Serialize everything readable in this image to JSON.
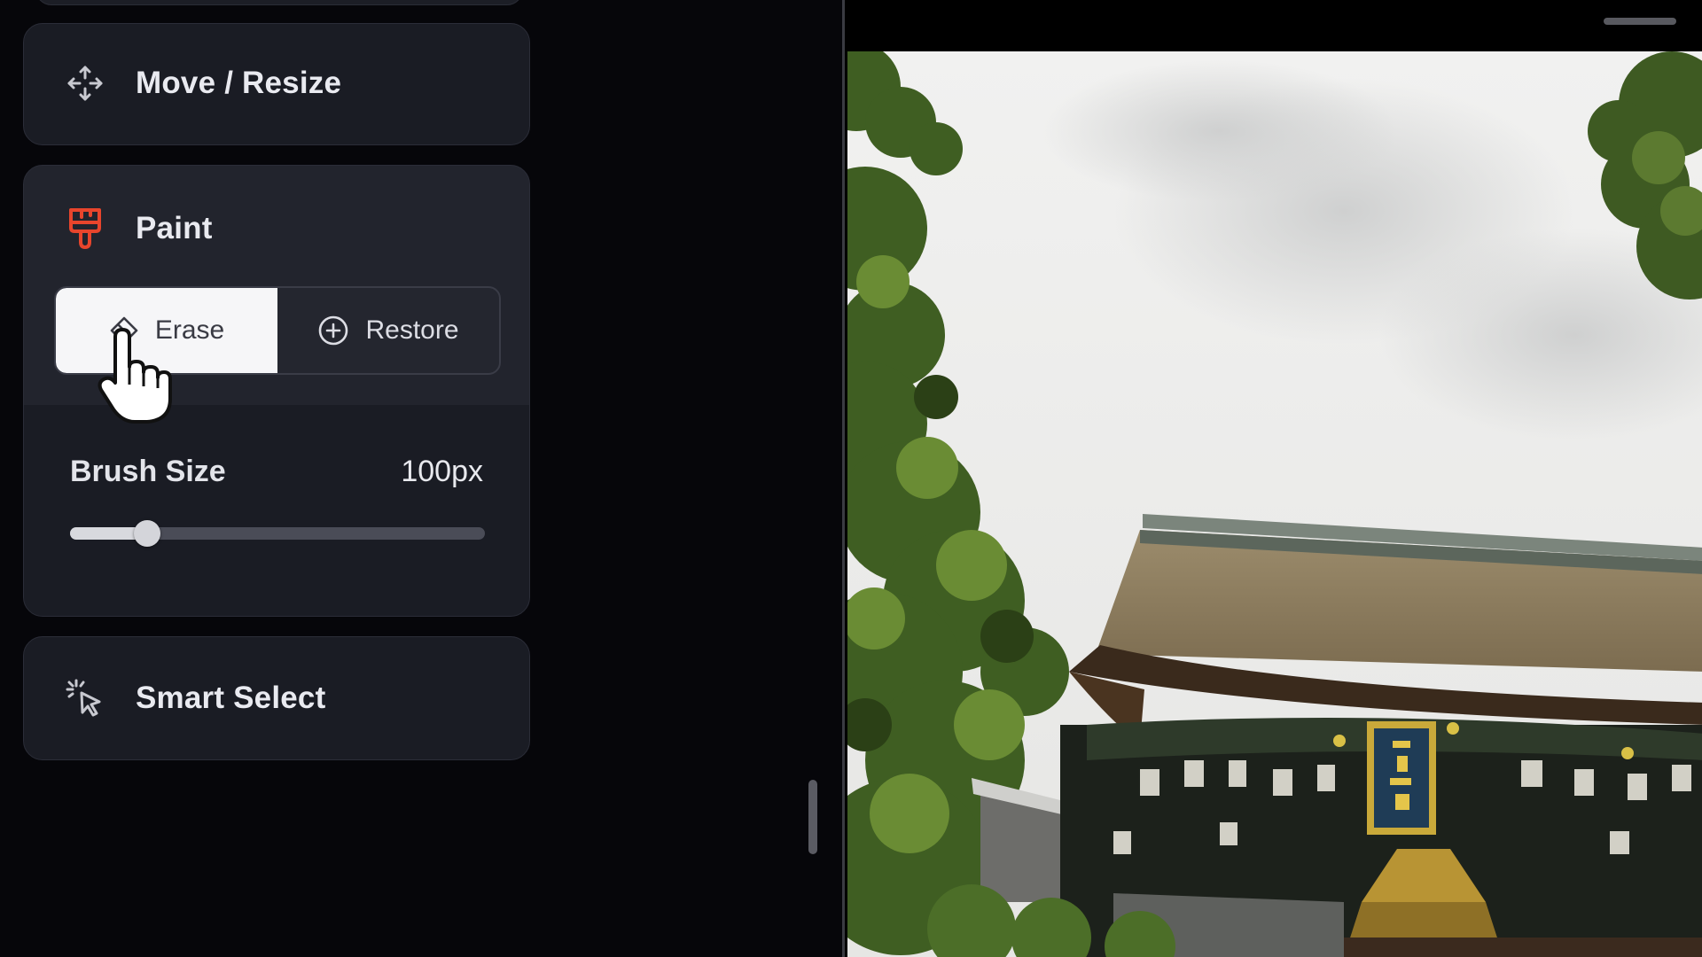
{
  "tools": {
    "move_resize": {
      "label": "Move / Resize",
      "icon": "move-arrows-icon"
    },
    "paint": {
      "label": "Paint",
      "icon": "paint-brush-icon",
      "icon_color": "#e8452c",
      "modes": [
        {
          "label": "Erase",
          "icon": "eraser-icon",
          "active": true
        },
        {
          "label": "Restore",
          "icon": "plus-circle-icon",
          "active": false
        }
      ],
      "brush_size": {
        "label": "Brush Size",
        "value_text": "100px",
        "fraction": 0.185
      }
    },
    "smart_select": {
      "label": "Smart Select",
      "icon": "sparkle-cursor-icon"
    }
  },
  "canvas": {
    "image_subject": "temple-gate-photo",
    "colors": {
      "sky": "#ebebea",
      "foliage": "#4c6b2a",
      "roof": "#8a7a5c"
    }
  }
}
